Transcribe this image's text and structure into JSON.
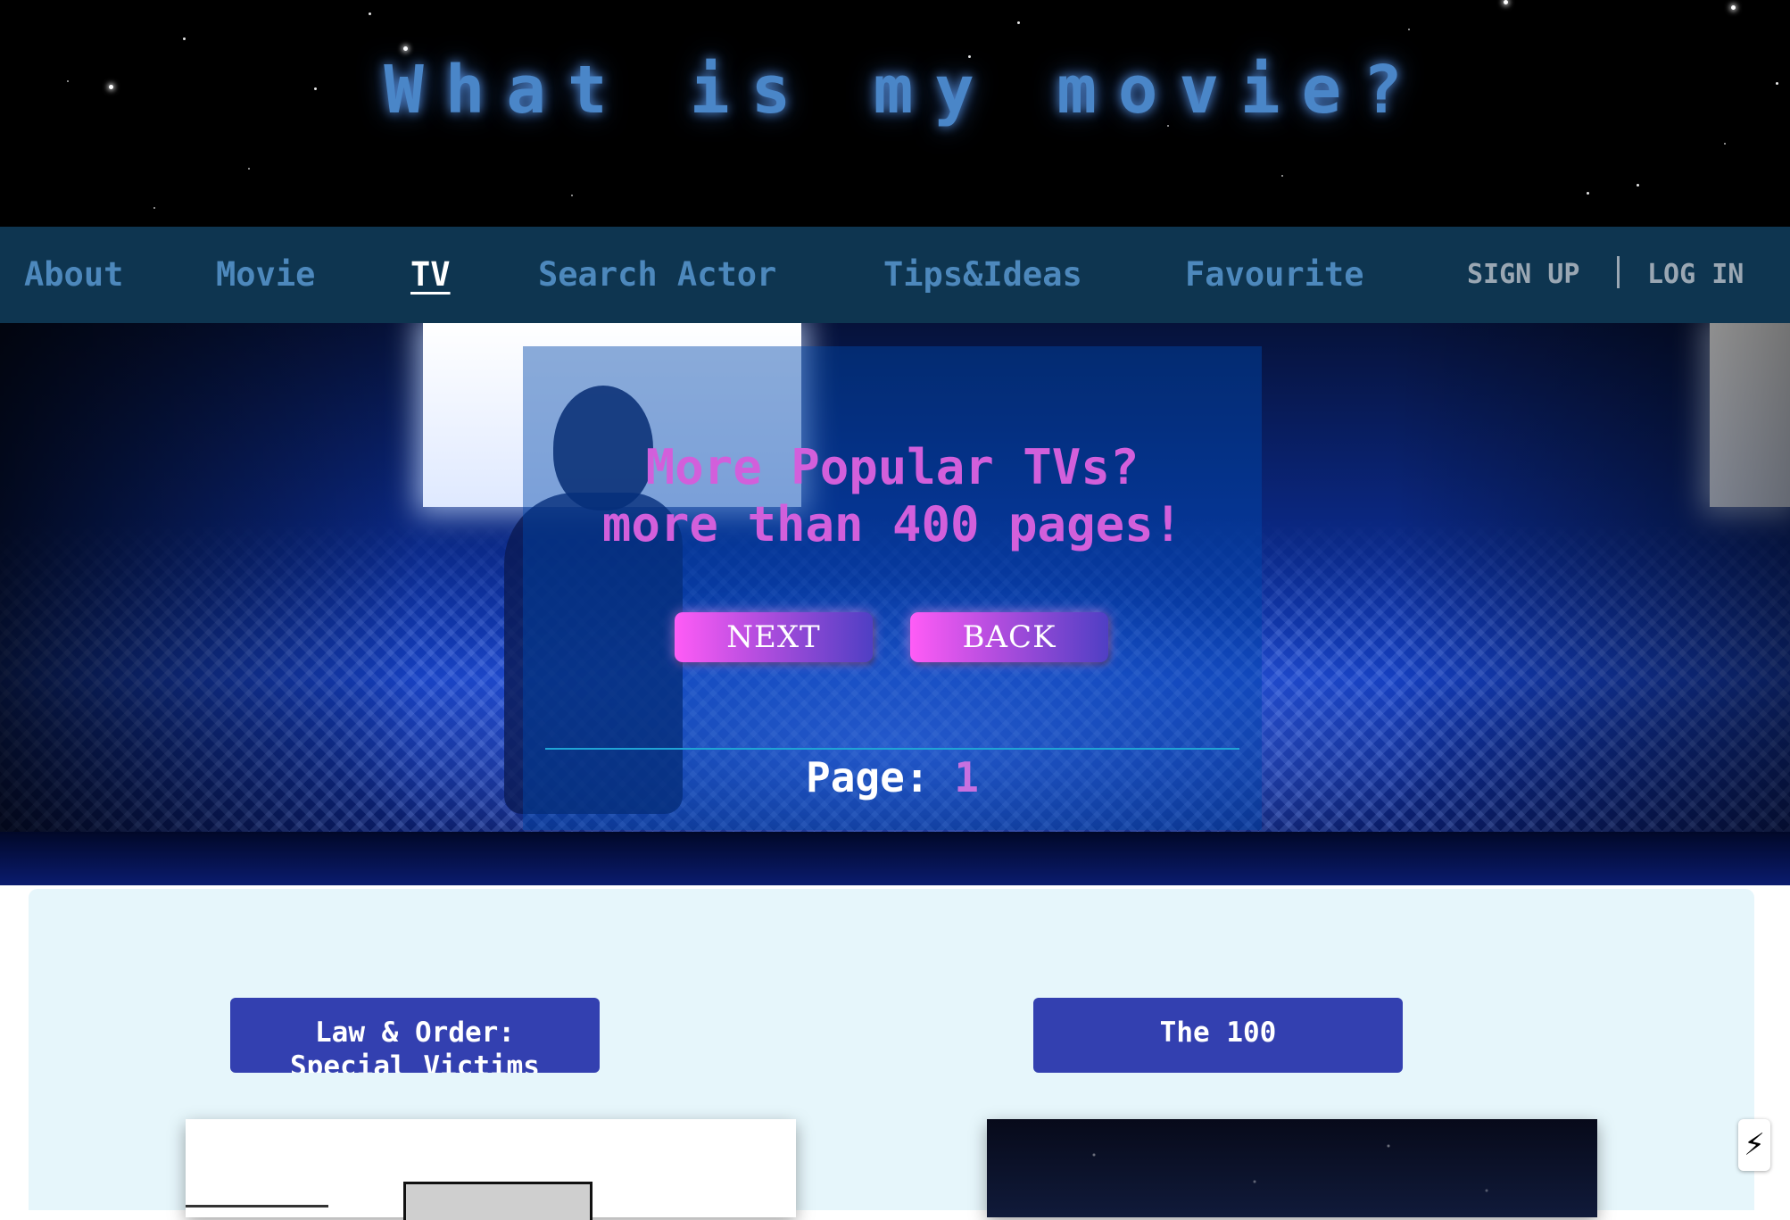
{
  "header": {
    "title": "What is my movie?"
  },
  "nav": {
    "items": [
      {
        "label": "About"
      },
      {
        "label": "Movie"
      },
      {
        "label": "TV",
        "active": true
      },
      {
        "label": "Search Actor"
      },
      {
        "label": "Tips&Ideas"
      },
      {
        "label": "Favourite"
      }
    ],
    "sign_up": "SIGN UP",
    "log_in": "LOG IN"
  },
  "hero": {
    "title_line1": "More Popular TVs?",
    "title_line2": "more than 400 pages!",
    "next_label": "NEXT",
    "back_label": "BACK",
    "page_label": "Page:",
    "page_number": "1"
  },
  "cards": [
    {
      "title": "Law & Order: Special Victims Unit"
    },
    {
      "title": "The 100"
    }
  ],
  "icons": {
    "floating_action": "lightning-bolt-icon"
  },
  "colors": {
    "nav_bg": "#0e3550",
    "nav_text": "#4d88bc",
    "title_glow": "#4a86c8",
    "accent_pink": "#d25fdb",
    "card_title_bg": "#3340b0",
    "content_bg": "#e6f6fb"
  }
}
